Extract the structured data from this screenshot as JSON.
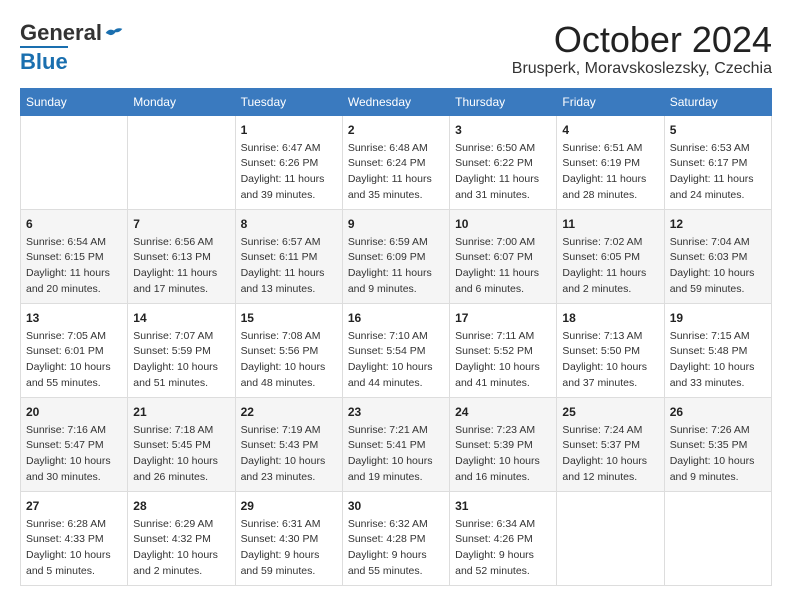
{
  "header": {
    "logo_general": "General",
    "logo_blue": "Blue",
    "month": "October 2024",
    "location": "Brusperk, Moravskoslezsky, Czechia"
  },
  "weekdays": [
    "Sunday",
    "Monday",
    "Tuesday",
    "Wednesday",
    "Thursday",
    "Friday",
    "Saturday"
  ],
  "weeks": [
    [
      {
        "day": "",
        "info": ""
      },
      {
        "day": "",
        "info": ""
      },
      {
        "day": "1",
        "info": "Sunrise: 6:47 AM\nSunset: 6:26 PM\nDaylight: 11 hours\nand 39 minutes."
      },
      {
        "day": "2",
        "info": "Sunrise: 6:48 AM\nSunset: 6:24 PM\nDaylight: 11 hours\nand 35 minutes."
      },
      {
        "day": "3",
        "info": "Sunrise: 6:50 AM\nSunset: 6:22 PM\nDaylight: 11 hours\nand 31 minutes."
      },
      {
        "day": "4",
        "info": "Sunrise: 6:51 AM\nSunset: 6:19 PM\nDaylight: 11 hours\nand 28 minutes."
      },
      {
        "day": "5",
        "info": "Sunrise: 6:53 AM\nSunset: 6:17 PM\nDaylight: 11 hours\nand 24 minutes."
      }
    ],
    [
      {
        "day": "6",
        "info": "Sunrise: 6:54 AM\nSunset: 6:15 PM\nDaylight: 11 hours\nand 20 minutes."
      },
      {
        "day": "7",
        "info": "Sunrise: 6:56 AM\nSunset: 6:13 PM\nDaylight: 11 hours\nand 17 minutes."
      },
      {
        "day": "8",
        "info": "Sunrise: 6:57 AM\nSunset: 6:11 PM\nDaylight: 11 hours\nand 13 minutes."
      },
      {
        "day": "9",
        "info": "Sunrise: 6:59 AM\nSunset: 6:09 PM\nDaylight: 11 hours\nand 9 minutes."
      },
      {
        "day": "10",
        "info": "Sunrise: 7:00 AM\nSunset: 6:07 PM\nDaylight: 11 hours\nand 6 minutes."
      },
      {
        "day": "11",
        "info": "Sunrise: 7:02 AM\nSunset: 6:05 PM\nDaylight: 11 hours\nand 2 minutes."
      },
      {
        "day": "12",
        "info": "Sunrise: 7:04 AM\nSunset: 6:03 PM\nDaylight: 10 hours\nand 59 minutes."
      }
    ],
    [
      {
        "day": "13",
        "info": "Sunrise: 7:05 AM\nSunset: 6:01 PM\nDaylight: 10 hours\nand 55 minutes."
      },
      {
        "day": "14",
        "info": "Sunrise: 7:07 AM\nSunset: 5:59 PM\nDaylight: 10 hours\nand 51 minutes."
      },
      {
        "day": "15",
        "info": "Sunrise: 7:08 AM\nSunset: 5:56 PM\nDaylight: 10 hours\nand 48 minutes."
      },
      {
        "day": "16",
        "info": "Sunrise: 7:10 AM\nSunset: 5:54 PM\nDaylight: 10 hours\nand 44 minutes."
      },
      {
        "day": "17",
        "info": "Sunrise: 7:11 AM\nSunset: 5:52 PM\nDaylight: 10 hours\nand 41 minutes."
      },
      {
        "day": "18",
        "info": "Sunrise: 7:13 AM\nSunset: 5:50 PM\nDaylight: 10 hours\nand 37 minutes."
      },
      {
        "day": "19",
        "info": "Sunrise: 7:15 AM\nSunset: 5:48 PM\nDaylight: 10 hours\nand 33 minutes."
      }
    ],
    [
      {
        "day": "20",
        "info": "Sunrise: 7:16 AM\nSunset: 5:47 PM\nDaylight: 10 hours\nand 30 minutes."
      },
      {
        "day": "21",
        "info": "Sunrise: 7:18 AM\nSunset: 5:45 PM\nDaylight: 10 hours\nand 26 minutes."
      },
      {
        "day": "22",
        "info": "Sunrise: 7:19 AM\nSunset: 5:43 PM\nDaylight: 10 hours\nand 23 minutes."
      },
      {
        "day": "23",
        "info": "Sunrise: 7:21 AM\nSunset: 5:41 PM\nDaylight: 10 hours\nand 19 minutes."
      },
      {
        "day": "24",
        "info": "Sunrise: 7:23 AM\nSunset: 5:39 PM\nDaylight: 10 hours\nand 16 minutes."
      },
      {
        "day": "25",
        "info": "Sunrise: 7:24 AM\nSunset: 5:37 PM\nDaylight: 10 hours\nand 12 minutes."
      },
      {
        "day": "26",
        "info": "Sunrise: 7:26 AM\nSunset: 5:35 PM\nDaylight: 10 hours\nand 9 minutes."
      }
    ],
    [
      {
        "day": "27",
        "info": "Sunrise: 6:28 AM\nSunset: 4:33 PM\nDaylight: 10 hours\nand 5 minutes."
      },
      {
        "day": "28",
        "info": "Sunrise: 6:29 AM\nSunset: 4:32 PM\nDaylight: 10 hours\nand 2 minutes."
      },
      {
        "day": "29",
        "info": "Sunrise: 6:31 AM\nSunset: 4:30 PM\nDaylight: 9 hours\nand 59 minutes."
      },
      {
        "day": "30",
        "info": "Sunrise: 6:32 AM\nSunset: 4:28 PM\nDaylight: 9 hours\nand 55 minutes."
      },
      {
        "day": "31",
        "info": "Sunrise: 6:34 AM\nSunset: 4:26 PM\nDaylight: 9 hours\nand 52 minutes."
      },
      {
        "day": "",
        "info": ""
      },
      {
        "day": "",
        "info": ""
      }
    ]
  ]
}
